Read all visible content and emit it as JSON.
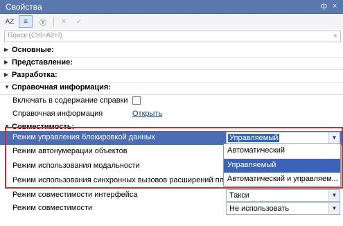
{
  "window": {
    "title": "Свойства",
    "controls": [
      "ф",
      "×"
    ]
  },
  "toolbar": {
    "sort_label": "AZ",
    "categories_label": "≡",
    "filter_label": "Ⓨ",
    "close_label": "✕",
    "confirm_label": "✓"
  },
  "search": {
    "placeholder": "Поиск (Ctrl+Alt+I)",
    "clear": "×"
  },
  "groups": {
    "main": {
      "label": "Основные:",
      "arrow": "▶"
    },
    "presentation": {
      "label": "Представление:",
      "arrow": "▶"
    },
    "development": {
      "label": "Разработка:",
      "arrow": "▶"
    },
    "help": {
      "label": "Справочная информация:",
      "arrow": "▼"
    },
    "compat": {
      "label": "Совместимость:",
      "arrow": "▼"
    }
  },
  "help_props": {
    "include_label": "Включать в содержание справки",
    "info_label": "Справочная информация",
    "info_link": "Открыть"
  },
  "compat_props": [
    {
      "label": "Режим управления блокировкой данных",
      "value": "Управляемый"
    },
    {
      "label": "Режим автонумерации объектов",
      "value": ""
    },
    {
      "label": "Режим использования модальности",
      "value": ""
    },
    {
      "label": "Режим использования синхронных вызовов расширений пл...",
      "value": ""
    },
    {
      "label": "Режим совместимости интерфейса",
      "value": "Такси"
    },
    {
      "label": "Режим совместимости",
      "value": "Не использовать"
    }
  ],
  "dropdown_options": [
    "Автоматический",
    "Управляемый",
    "Автоматический и управляем..."
  ],
  "dropdown_arrow": "▼",
  "colors": {
    "titlebar": "#5b78ad",
    "selection": "#4a6db6",
    "highlight_frame": "#d02c2c",
    "link": "#1a3f86"
  }
}
